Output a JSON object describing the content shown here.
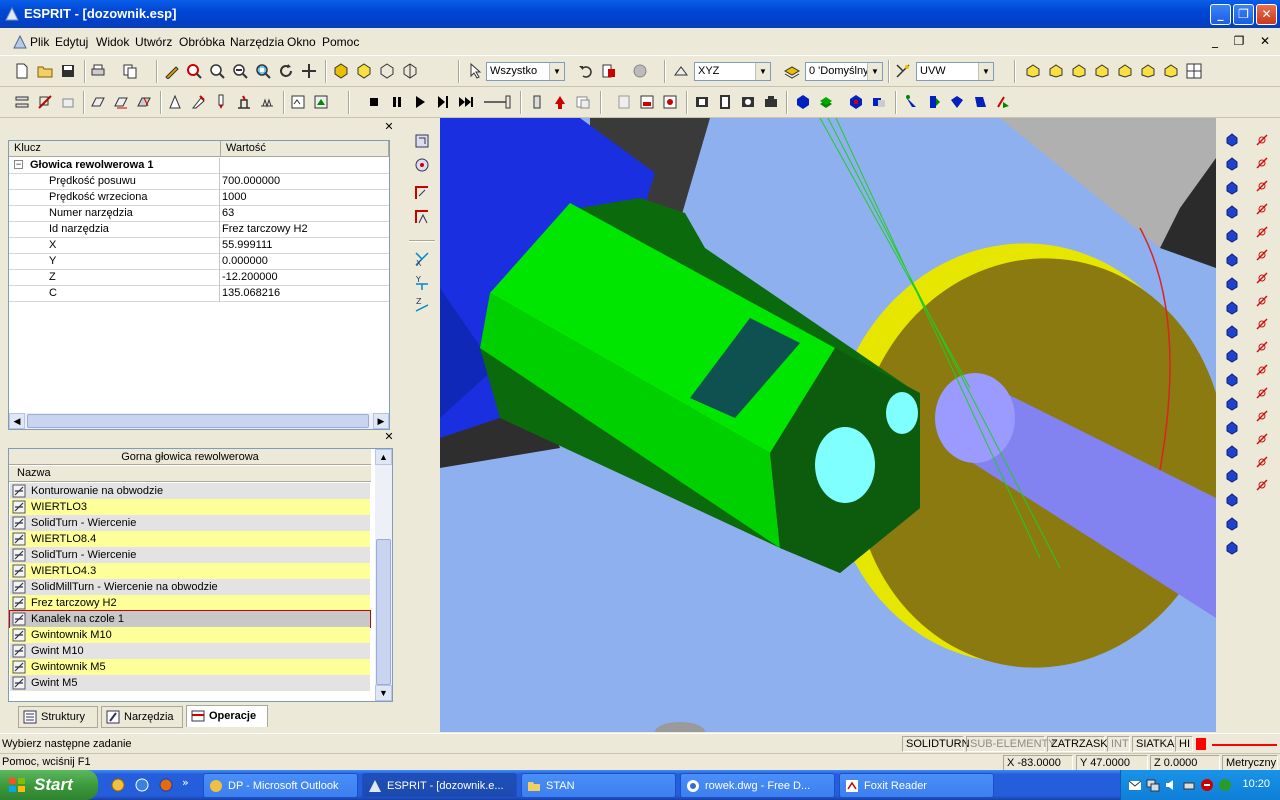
{
  "window": {
    "title": "ESPRIT - [dozownik.esp]"
  },
  "menu": {
    "items": [
      "Plik",
      "Edytuj",
      "Widok",
      "Utwórz",
      "Obróbka",
      "Narzędzia",
      "Okno",
      "Pomoc"
    ]
  },
  "toolbar": {
    "selection_combo": "Wszystko",
    "plane_combo": "XYZ",
    "layer_combo": "0 'Domyślny",
    "workplane_combo": "UVW"
  },
  "properties": {
    "col_key": "Klucz",
    "col_value": "Wartość",
    "group": "Głowica rewolwerowa 1",
    "rows": [
      {
        "key": "Prędkość posuwu",
        "value": "700.000000"
      },
      {
        "key": "Prędkość wrzeciona",
        "value": "1000"
      },
      {
        "key": "Numer narzędzia",
        "value": "63"
      },
      {
        "key": "Id narzędzia",
        "value": "Frez tarczowy H2"
      },
      {
        "key": "X",
        "value": "55.999111"
      },
      {
        "key": "Y",
        "value": "0.000000"
      },
      {
        "key": "Z",
        "value": "-12.200000"
      },
      {
        "key": "C",
        "value": "135.068216"
      }
    ]
  },
  "operations": {
    "caption": "Gorna głowica rewolwerowa",
    "column": "Nazwa",
    "items": [
      {
        "label": "Konturowanie na obwodzie",
        "style": "gray",
        "icon": "contour-icon"
      },
      {
        "label": "WIERTLO3",
        "style": "yellow",
        "icon": "drill-tool-icon"
      },
      {
        "label": "SolidTurn - Wiercenie",
        "style": "gray",
        "icon": "drilling-op-icon"
      },
      {
        "label": "WIERTLO8.4",
        "style": "yellow",
        "icon": "drill-tool-icon"
      },
      {
        "label": "SolidTurn - Wiercenie",
        "style": "gray",
        "icon": "drilling-op-icon"
      },
      {
        "label": "WIERTLO4.3",
        "style": "yellow",
        "icon": "drill-tool-icon"
      },
      {
        "label": "SolidMillTurn - Wiercenie na obwodzie",
        "style": "gray",
        "icon": "drilling-op-icon"
      },
      {
        "label": "Frez tarczowy H2",
        "style": "yellow",
        "icon": "disc-cutter-icon"
      },
      {
        "label": "Kanalek na czole 1",
        "style": "selected",
        "icon": "groove-op-icon"
      },
      {
        "label": "Gwintownik M10",
        "style": "yellow",
        "icon": "tap-tool-icon"
      },
      {
        "label": "Gwint M10",
        "style": "gray",
        "icon": "thread-op-icon"
      },
      {
        "label": "Gwintownik M5",
        "style": "yellow",
        "icon": "tap-tool-icon"
      },
      {
        "label": "Gwint M5",
        "style": "gray",
        "icon": "thread-op-icon"
      }
    ]
  },
  "tabs": [
    {
      "label": "Struktury",
      "active": false
    },
    {
      "label": "Narzędzia",
      "active": false
    },
    {
      "label": "Operacje",
      "active": true
    }
  ],
  "status": {
    "prompt": "Wybierz następne zadanie",
    "help": "Pomoc, wciśnij F1",
    "modes": [
      "SOLIDTURN",
      "SUB-ELEMENTY",
      "ZATRZASK",
      "INT",
      "SIATKA",
      "HI"
    ],
    "x": "X -83.0000",
    "y": "Y 47.0000",
    "z": "Z 0.0000",
    "units": "Metryczny"
  },
  "taskbar": {
    "start": "Start",
    "tasks": [
      "DP - Microsoft Outlook",
      "ESPRIT - [dozownik.e...",
      "STAN",
      "rowek.dwg - Free D...",
      "Foxit Reader"
    ],
    "clock": "10:20"
  },
  "colors": {
    "selection_yellow": "#ffff99",
    "row_gray": "#e3e3e3",
    "viewport_bg": "#8fb0ef",
    "part_green": "#00e600"
  }
}
